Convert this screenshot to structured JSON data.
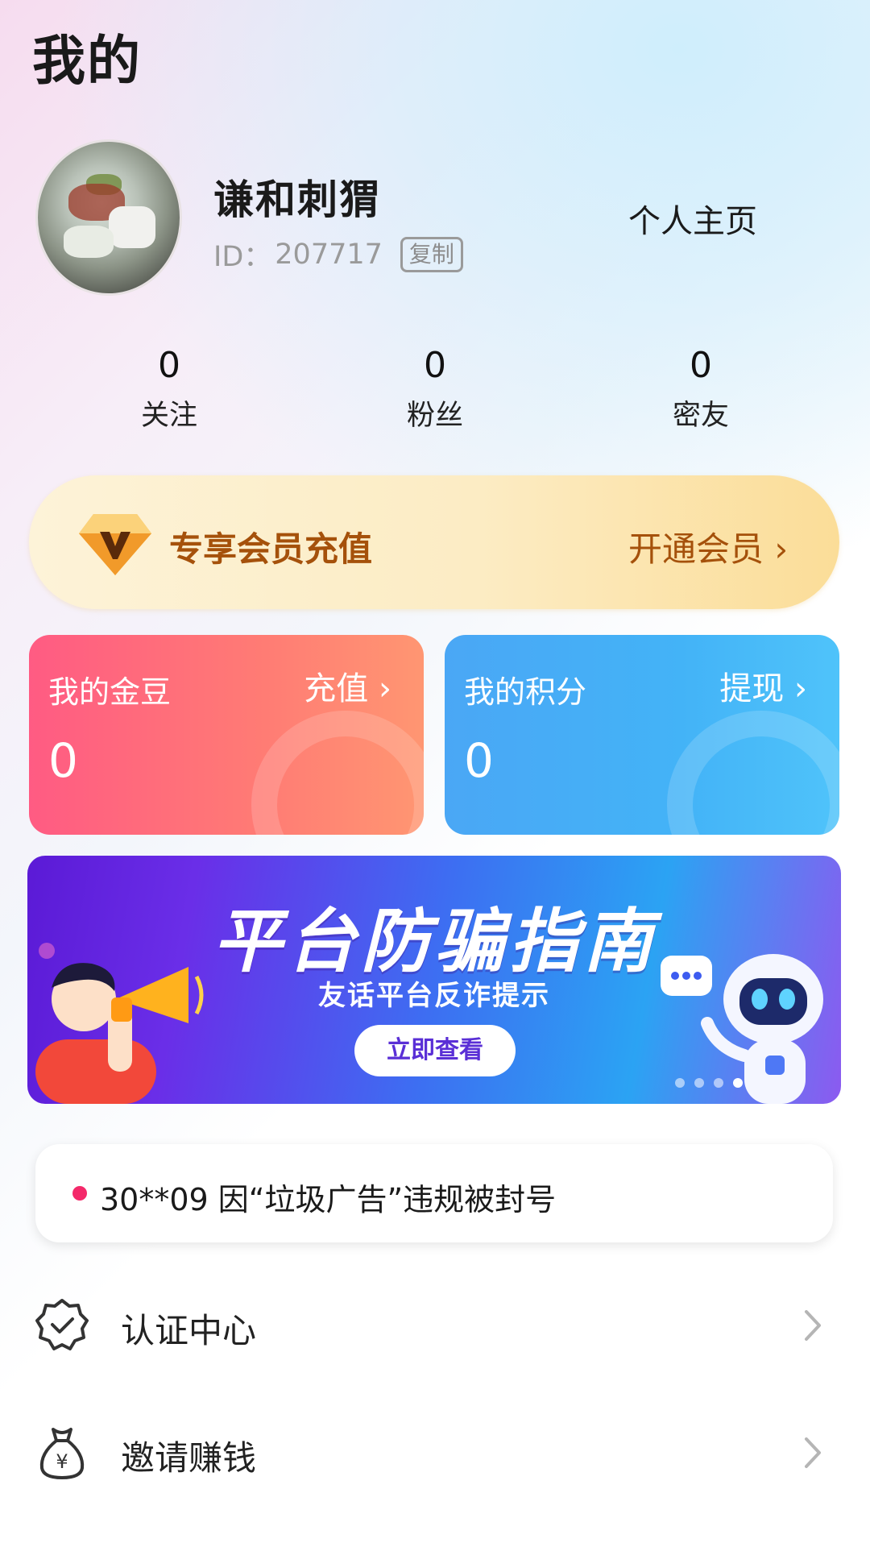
{
  "page_title": "我的",
  "profile": {
    "nickname": "谦和刺猬",
    "id_label": "ID：",
    "id_value": "207717",
    "copy_label": "复制",
    "homepage_label": "个人主页"
  },
  "stats": [
    {
      "value": "0",
      "label": "关注"
    },
    {
      "value": "0",
      "label": "粉丝"
    },
    {
      "value": "0",
      "label": "密友"
    }
  ],
  "vip": {
    "title": "专享会员充值",
    "action": "开通会员 ›",
    "icon": "diamond-v-icon"
  },
  "cards": {
    "gold": {
      "title": "我的金豆",
      "action": "充值 ›",
      "value": "0",
      "color": "#ff6a7a"
    },
    "points": {
      "title": "我的积分",
      "action": "提现 ›",
      "value": "0",
      "color": "#43b0f6"
    }
  },
  "promo": {
    "title": "平台防骗指南",
    "subtitle": "友话平台反诈提示",
    "button": "立即查看"
  },
  "notice": {
    "text": "30**09 因“垃圾广告”违规被封号",
    "dot_color": "#f4296a"
  },
  "menu": [
    {
      "label": "认证中心",
      "icon": "verified-badge-icon"
    },
    {
      "label": "邀请赚钱",
      "icon": "money-bag-icon"
    }
  ]
}
